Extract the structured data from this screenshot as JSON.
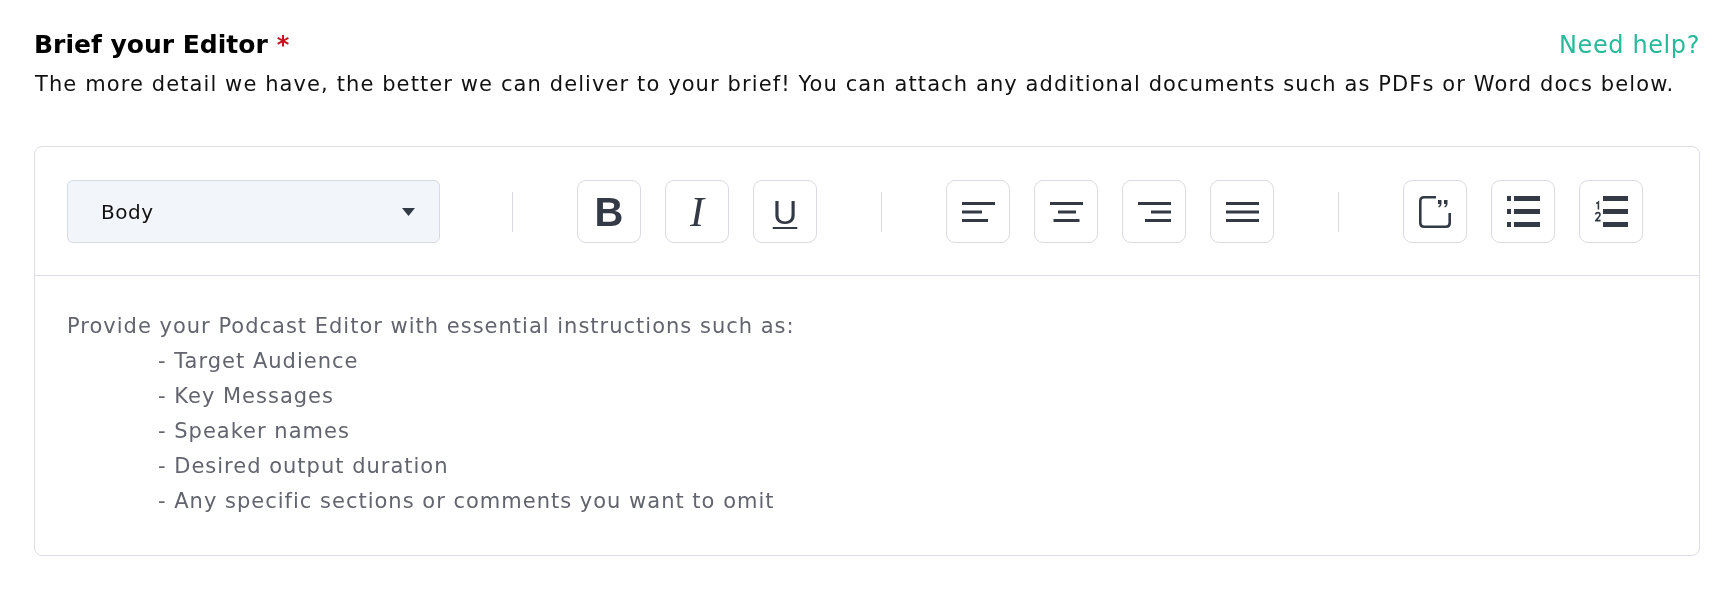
{
  "header": {
    "title": "Brief your Editor",
    "required_mark": "*",
    "help_link": "Need help?",
    "description": "The more detail we have, the better we can deliver to your brief! You can attach any additional documents such as PDFs or Word docs below."
  },
  "editor": {
    "block_style": {
      "value": "Body"
    },
    "toolbar_groups": [
      {
        "buttons": [
          {
            "kind": "bold",
            "label": "B"
          },
          {
            "kind": "italic",
            "label": "I"
          },
          {
            "kind": "underline",
            "label": "U"
          }
        ]
      },
      {
        "buttons": [
          {
            "kind": "align-left"
          },
          {
            "kind": "align-center"
          },
          {
            "kind": "align-right"
          },
          {
            "kind": "justify"
          }
        ]
      },
      {
        "buttons": [
          {
            "kind": "quote"
          },
          {
            "kind": "bulleted-list"
          },
          {
            "kind": "numbered-list"
          }
        ]
      }
    ],
    "placeholder": {
      "intro": "Provide your Podcast Editor with essential instructions such as:",
      "items": [
        "- Target Audience",
        "- Key Messages",
        "- Speaker names",
        "- Desired output duration",
        "- Any specific sections or comments you want to omit"
      ]
    }
  }
}
